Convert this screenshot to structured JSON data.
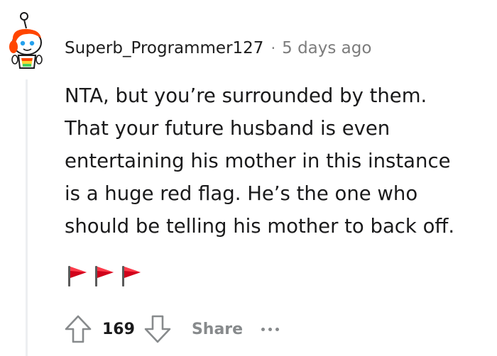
{
  "comment": {
    "author": "Superb_Programmer127",
    "separator": "·",
    "timestamp": "5 days ago",
    "body_lines": [
      "NTA, but you’re surrounded by them.",
      "That your future husband is even",
      "entertaining his mother in this instance",
      "is a huge red flag. He’s the one who",
      "should be telling his mother to back off."
    ],
    "emoji_line": "🚩🚩🚩",
    "flag_count": 3
  },
  "actions": {
    "upvote_icon": "upvote-arrow-icon",
    "score": "169",
    "downvote_icon": "downvote-arrow-icon",
    "share_label": "Share",
    "more_icon": "ellipsis-icon"
  },
  "colors": {
    "meta_text": "#7c7c7c",
    "action_grey": "#878a8c",
    "flag_red": "#d0021b",
    "avatar_orange": "#ff4500",
    "thread_line": "#edeff1"
  }
}
